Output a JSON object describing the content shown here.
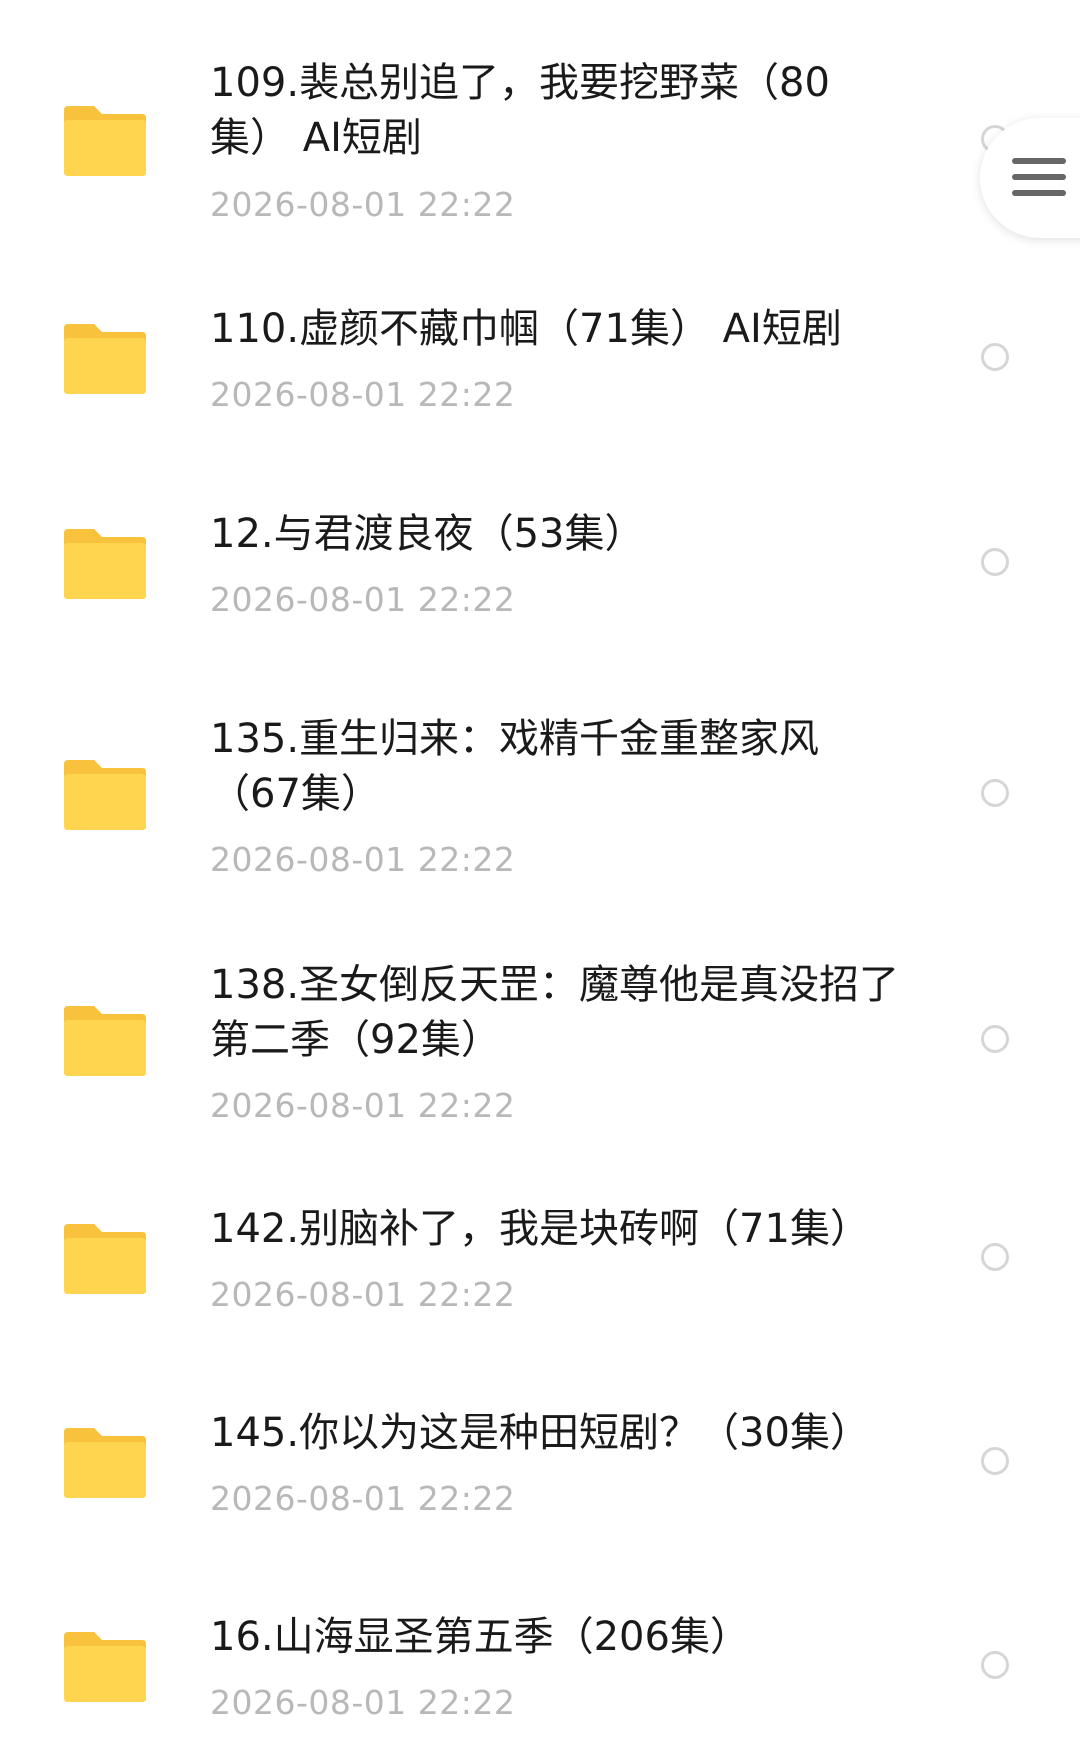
{
  "items": [
    {
      "title": "109.裴总别追了，我要挖野菜（80集） AI短剧",
      "date": "2026-08-01  22:22"
    },
    {
      "title": "110.虚颜不藏巾帼（71集） AI短剧",
      "date": "2026-08-01  22:22"
    },
    {
      "title": "12.与君渡良夜（53集）",
      "date": "2026-08-01  22:22"
    },
    {
      "title": "135.重生归来：戏精千金重整家风（67集）",
      "date": "2026-08-01  22:22"
    },
    {
      "title": "138.圣女倒反天罡：魔尊他是真没招了第二季（92集）",
      "date": "2026-08-01  22:22"
    },
    {
      "title": "142.别脑补了，我是块砖啊（71集）",
      "date": "2026-08-01  22:22"
    },
    {
      "title": "145.你以为这是种田短剧？（30集）",
      "date": "2026-08-01  22:22"
    },
    {
      "title": "16.山海显圣第五季（206集）",
      "date": "2026-08-01  22:22"
    }
  ],
  "icons": {
    "folder": "folder-icon",
    "select": "radio-circle-icon",
    "menu": "hamburger-menu-icon"
  },
  "colors": {
    "folder": "#FFD24A",
    "title": "#1a1a1a",
    "date": "#b8b8b8"
  }
}
